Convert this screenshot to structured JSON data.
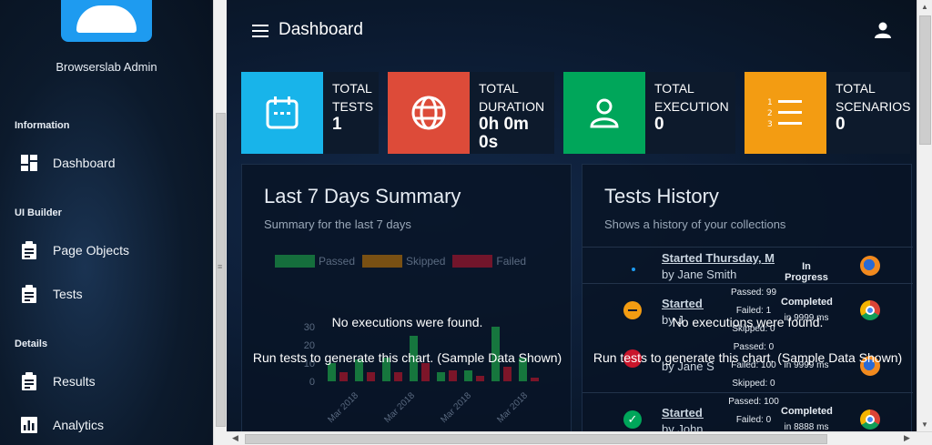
{
  "sidebar": {
    "admin_name": "Browserslab Admin",
    "sections": {
      "information": "Information",
      "ui_builder": "UI Builder",
      "details": "Details"
    },
    "items": {
      "dashboard": "Dashboard",
      "page_objects": "Page Objects",
      "tests": "Tests",
      "results": "Results",
      "analytics": "Analytics"
    }
  },
  "header": {
    "title": "Dashboard"
  },
  "stats": [
    {
      "label1": "TOTAL",
      "label2": "TESTS",
      "value": "1",
      "color": "#18b4ea",
      "icon": "calendar-icon"
    },
    {
      "label1": "TOTAL",
      "label2": "DURATION",
      "value": "0h 0m",
      "value2": "0s",
      "color": "#dd4b39",
      "icon": "globe-icon"
    },
    {
      "label1": "TOTAL",
      "label2": "EXECUTION",
      "value": "0",
      "color": "#00a65a",
      "icon": "user-icon"
    },
    {
      "label1": "TOTAL",
      "label2": "SCENARIOS",
      "value": "0",
      "color": "#f39c12",
      "icon": "numbered-list-icon"
    }
  ],
  "summary": {
    "title": "Last 7 Days Summary",
    "subtitle": "Summary for the last 7 days",
    "empty_message": "No executions were found.",
    "hint": "Run tests to generate this chart. (Sample Data Shown)"
  },
  "history": {
    "title": "Tests History",
    "subtitle": "Shows a history of your collections",
    "empty_message": "No executions were found.",
    "hint": "Run tests to generate this chart. (Sample Data Shown)",
    "rows": [
      {
        "link": "Started Thursday, M",
        "by": "by Jane Smith",
        "status": "In Progress"
      },
      {
        "link": "Started T",
        "by": "by J",
        "status": "Completed",
        "passed": "Passed: 99",
        "failed": "Failed: 1",
        "skipped": "Skipped: 0",
        "ms": "in 9999 ms"
      },
      {
        "link": "Started T",
        "by": "by Jane S",
        "status": "Completed",
        "passed": "Passed: 0",
        "failed": "Failed: 100",
        "skipped": "Skipped: 0",
        "ms": "in 9999 ms"
      },
      {
        "link": "Started T",
        "by": "by John",
        "status": "Completed",
        "passed": "Passed: 100",
        "failed": "Failed: 0",
        "ms": "in 8888 ms"
      }
    ]
  },
  "chart_data": {
    "type": "bar",
    "title": "",
    "legend": [
      "Passed",
      "Skipped",
      "Failed"
    ],
    "ylim": [
      0,
      30
    ],
    "yticks": [
      "30",
      "20",
      "10",
      "0"
    ],
    "xticks": [
      "Mar 2018",
      "Mar 2018",
      "Mar 2018",
      "Mar 2018"
    ],
    "series": [
      {
        "name": "Passed",
        "color": "#1fb84d",
        "values": [
          10,
          12,
          13,
          25,
          5,
          6,
          30,
          13
        ]
      },
      {
        "name": "Skipped",
        "color": "#d68100",
        "values": [
          0,
          0,
          0,
          0,
          0,
          0,
          0,
          0
        ]
      },
      {
        "name": "Failed",
        "color": "#c9152b",
        "values": [
          5,
          5,
          5,
          10,
          6,
          3,
          8,
          2
        ]
      }
    ]
  }
}
